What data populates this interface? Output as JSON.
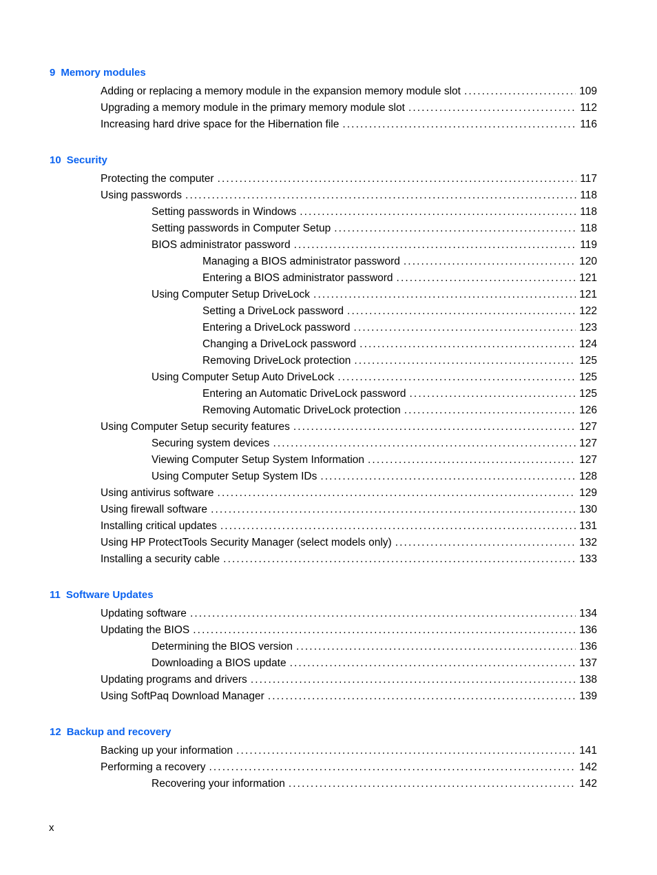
{
  "footer": {
    "page_label": "x"
  },
  "chapters": [
    {
      "number": "9",
      "title": "Memory modules",
      "entries": [
        {
          "level": 1,
          "title": "Adding or replacing a memory module in the expansion memory module slot",
          "page": "109"
        },
        {
          "level": 1,
          "title": "Upgrading a memory module in the primary memory module slot",
          "page": "112"
        },
        {
          "level": 1,
          "title": "Increasing hard drive space for the Hibernation file",
          "page": "116"
        }
      ]
    },
    {
      "number": "10",
      "title": "Security",
      "entries": [
        {
          "level": 1,
          "title": "Protecting the computer",
          "page": "117"
        },
        {
          "level": 1,
          "title": "Using passwords",
          "page": "118"
        },
        {
          "level": 2,
          "title": "Setting passwords in Windows",
          "page": "118"
        },
        {
          "level": 2,
          "title": "Setting passwords in Computer Setup",
          "page": "118"
        },
        {
          "level": 2,
          "title": "BIOS administrator password",
          "page": "119"
        },
        {
          "level": 3,
          "title": "Managing a BIOS administrator password",
          "page": "120"
        },
        {
          "level": 3,
          "title": "Entering a BIOS administrator password",
          "page": "121"
        },
        {
          "level": 2,
          "title": "Using Computer Setup DriveLock",
          "page": "121"
        },
        {
          "level": 3,
          "title": "Setting a DriveLock password",
          "page": "122"
        },
        {
          "level": 3,
          "title": "Entering a DriveLock password",
          "page": "123"
        },
        {
          "level": 3,
          "title": "Changing a DriveLock password",
          "page": "124"
        },
        {
          "level": 3,
          "title": "Removing DriveLock protection",
          "page": "125"
        },
        {
          "level": 2,
          "title": "Using Computer Setup Auto DriveLock",
          "page": "125"
        },
        {
          "level": 3,
          "title": "Entering an Automatic DriveLock password",
          "page": "125"
        },
        {
          "level": 3,
          "title": "Removing Automatic DriveLock protection",
          "page": "126"
        },
        {
          "level": 1,
          "title": "Using Computer Setup security features",
          "page": "127"
        },
        {
          "level": 2,
          "title": "Securing system devices",
          "page": "127"
        },
        {
          "level": 2,
          "title": "Viewing Computer Setup System Information",
          "page": "127"
        },
        {
          "level": 2,
          "title": "Using Computer Setup System IDs",
          "page": "128"
        },
        {
          "level": 1,
          "title": "Using antivirus software",
          "page": "129"
        },
        {
          "level": 1,
          "title": "Using firewall software",
          "page": "130"
        },
        {
          "level": 1,
          "title": "Installing critical updates",
          "page": "131"
        },
        {
          "level": 1,
          "title": "Using HP ProtectTools Security Manager (select models only)",
          "page": "132"
        },
        {
          "level": 1,
          "title": "Installing a security cable",
          "page": "133"
        }
      ]
    },
    {
      "number": "11",
      "title": "Software Updates",
      "entries": [
        {
          "level": 1,
          "title": "Updating software",
          "page": "134"
        },
        {
          "level": 1,
          "title": "Updating the BIOS",
          "page": "136"
        },
        {
          "level": 2,
          "title": "Determining the BIOS version",
          "page": "136"
        },
        {
          "level": 2,
          "title": "Downloading a BIOS update",
          "page": "137"
        },
        {
          "level": 1,
          "title": "Updating programs and drivers",
          "page": "138"
        },
        {
          "level": 1,
          "title": "Using SoftPaq Download Manager",
          "page": "139"
        }
      ]
    },
    {
      "number": "12",
      "title": "Backup and recovery",
      "entries": [
        {
          "level": 1,
          "title": "Backing up your information",
          "page": "141"
        },
        {
          "level": 1,
          "title": "Performing a recovery",
          "page": "142"
        },
        {
          "level": 2,
          "title": "Recovering your information",
          "page": "142"
        }
      ]
    }
  ]
}
